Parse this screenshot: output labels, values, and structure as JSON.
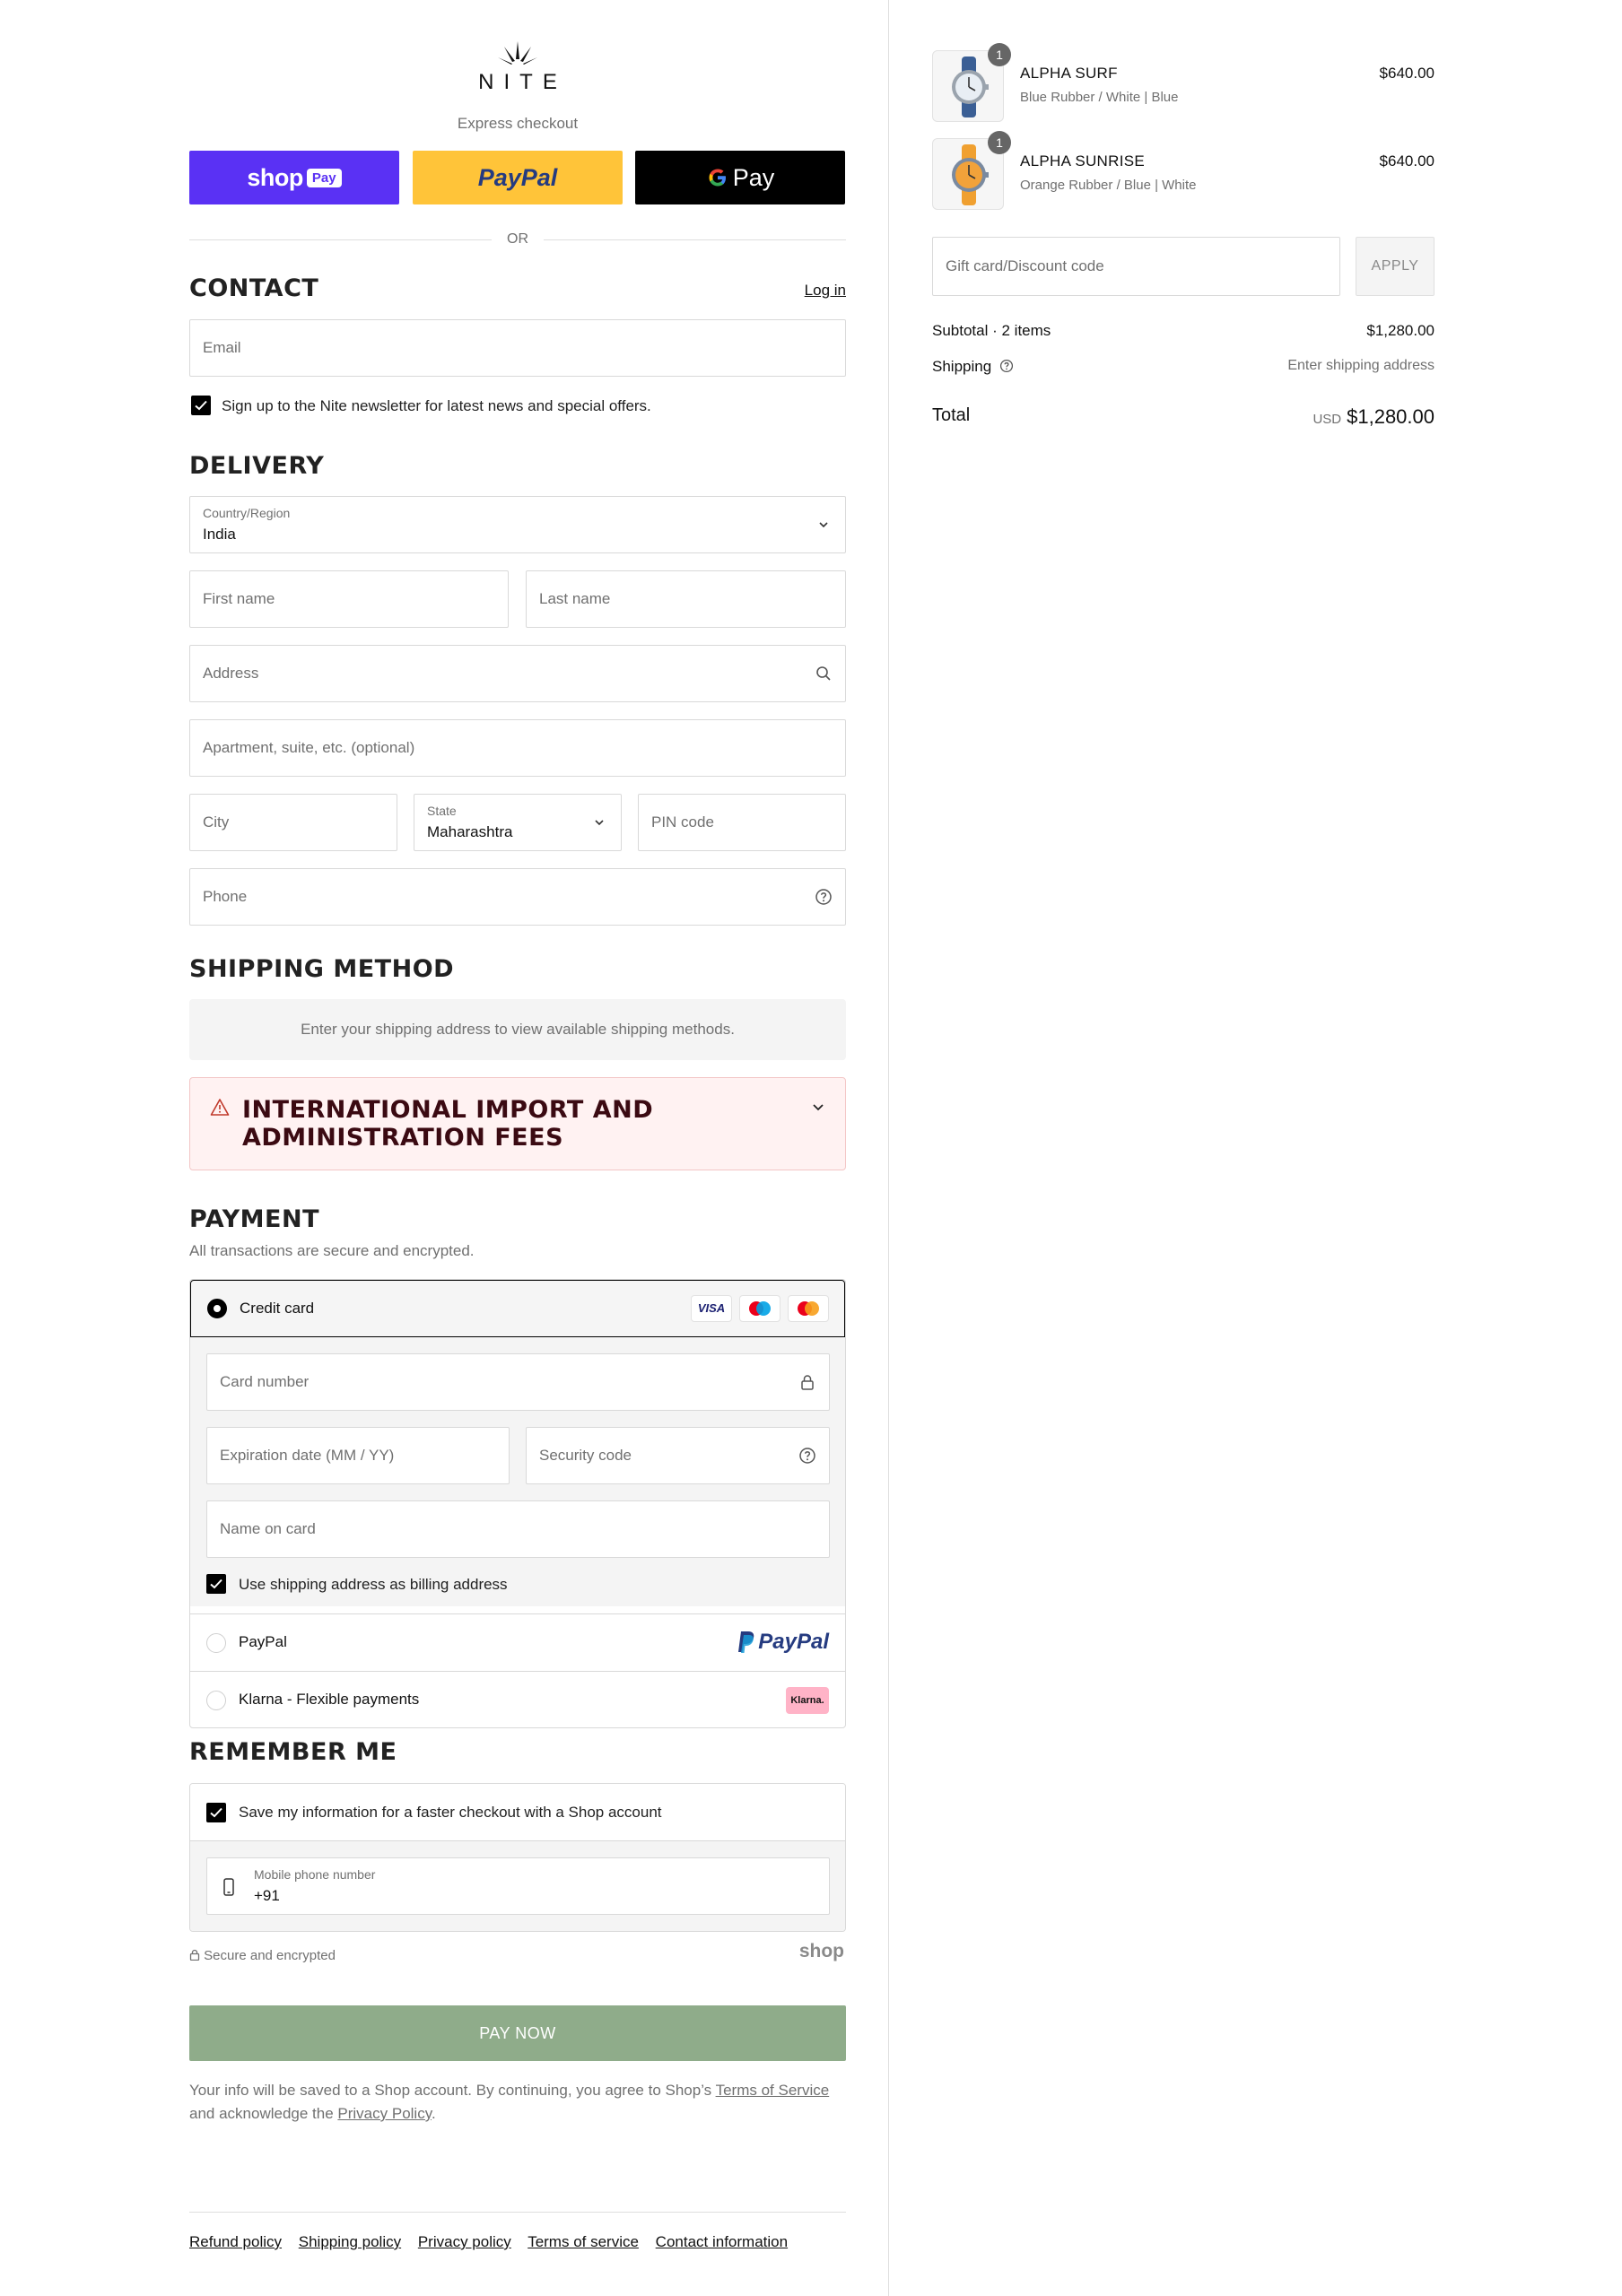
{
  "brand": {
    "name": "NITE"
  },
  "express": {
    "label": "Express checkout",
    "shop_pay": "shop",
    "shop_pay_badge": "Pay",
    "paypal": "PayPal",
    "gpay": "Pay",
    "or": "OR"
  },
  "contact": {
    "title": "CONTACT",
    "login": "Log in",
    "email_placeholder": "Email",
    "newsletter_label": "Sign up to the Nite newsletter for latest news and special offers."
  },
  "delivery": {
    "title": "DELIVERY",
    "country_label": "Country/Region",
    "country_value": "India",
    "first_name": "First name",
    "last_name": "Last name",
    "address": "Address",
    "apartment": "Apartment, suite, etc. (optional)",
    "city": "City",
    "state_label": "State",
    "state_value": "Maharashtra",
    "pin": "PIN code",
    "phone": "Phone"
  },
  "shipping_method": {
    "title": "SHIPPING METHOD",
    "notice": "Enter your shipping address to view available shipping methods."
  },
  "fees": {
    "title_line1": "INTERNATIONAL IMPORT AND",
    "title_line2": "ADMINISTRATION FEES"
  },
  "payment": {
    "title": "PAYMENT",
    "subtitle": "All transactions are secure and encrypted.",
    "credit_card": "Credit card",
    "card_brands": [
      "VISA",
      "maestro",
      "mastercard"
    ],
    "card_number": "Card number",
    "expiration": "Expiration date (MM / YY)",
    "security": "Security code",
    "name_on_card": "Name on card",
    "billing_same": "Use shipping address as billing address",
    "paypal": "PayPal",
    "paypal_logo": "PayPal",
    "klarna": "Klarna - Flexible payments",
    "klarna_logo": "Klarna."
  },
  "remember": {
    "title": "REMEMBER ME",
    "save_label": "Save my information for a faster checkout with a Shop account",
    "mobile_label": "Mobile phone number",
    "mobile_value": "+91",
    "secure": "Secure and encrypted",
    "shop_logo": "shop"
  },
  "pay_now": "PAY NOW",
  "legal": {
    "text_a": "Your info will be saved to a Shop account. By continuing, you agree to Shop’s ",
    "terms": "Terms of Service",
    "text_b": "and acknowledge the ",
    "privacy": "Privacy Policy",
    "text_c": "."
  },
  "footer": {
    "links": [
      "Refund policy",
      "Shipping policy",
      "Privacy policy",
      "Terms of service",
      "Contact information"
    ]
  },
  "summary": {
    "items": [
      {
        "name": "ALPHA SURF",
        "variant": "Blue Rubber / White | Blue",
        "price": "$640.00",
        "qty": "1",
        "color": "#3b5f95",
        "dial": "#e8eef4"
      },
      {
        "name": "ALPHA SUNRISE",
        "variant": "Orange Rubber / Blue | White",
        "price": "$640.00",
        "qty": "1",
        "color": "#f0a030",
        "dial": "#f2a23a"
      }
    ],
    "discount_placeholder": "Gift card/Discount code",
    "apply": "APPLY",
    "subtotal_label": "Subtotal · 2 items",
    "subtotal_value": "$1,280.00",
    "shipping_label": "Shipping",
    "shipping_value": "Enter shipping address",
    "total_label": "Total",
    "currency": "USD",
    "total_value": "$1,280.00"
  },
  "colors": {
    "shop_pay": "#5a31f4",
    "paypal": "#ffc439",
    "gpay": "#000000",
    "pay_now": "#8fac8a",
    "warning_bg": "#fff2f2"
  }
}
